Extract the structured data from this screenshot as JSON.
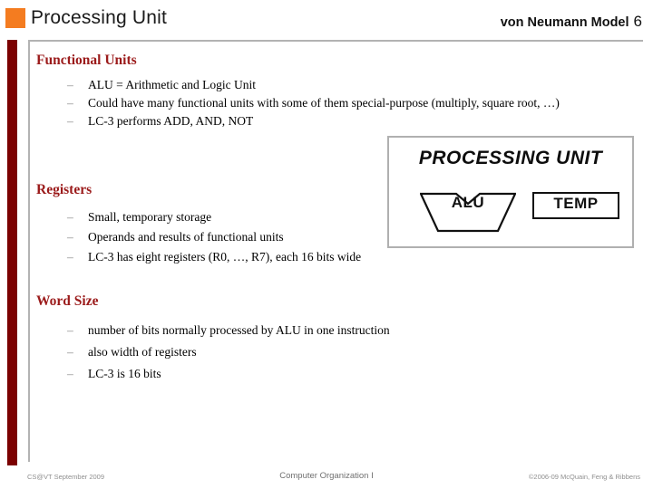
{
  "header": {
    "title": "Processing Unit",
    "subtitle": "von Neumann Model",
    "slide_number": "6",
    "marker_color": "#F47C20"
  },
  "theme": {
    "left_bar_color": "#7B0000",
    "heading_color": "#9B1B1B",
    "frame_color": "#b3b3b3"
  },
  "sections": [
    {
      "heading": "Functional Units",
      "bullets": [
        "ALU = Arithmetic and Logic Unit",
        "Could have many functional units with some of them special-purpose (multiply, square root, …)",
        "LC-3 performs ADD, AND, NOT"
      ]
    },
    {
      "heading": "Registers",
      "bullets": [
        "Small, temporary storage",
        "Operands and results of functional units",
        "LC-3 has eight registers (R0, …, R7), each 16 bits wide"
      ]
    },
    {
      "heading": "Word Size",
      "bullets": [
        "number of bits normally processed by ALU in one instruction",
        "also width of registers",
        "LC-3 is 16 bits"
      ]
    }
  ],
  "bullet_marker": "–",
  "diagram": {
    "title": "PROCESSING UNIT",
    "alu_label": "ALU",
    "temp_label": "TEMP"
  },
  "footer": {
    "left": "CS@VT September 2009",
    "center": "Computer Organization I",
    "right": "©2006-09 McQuain, Feng & Ribbens"
  }
}
